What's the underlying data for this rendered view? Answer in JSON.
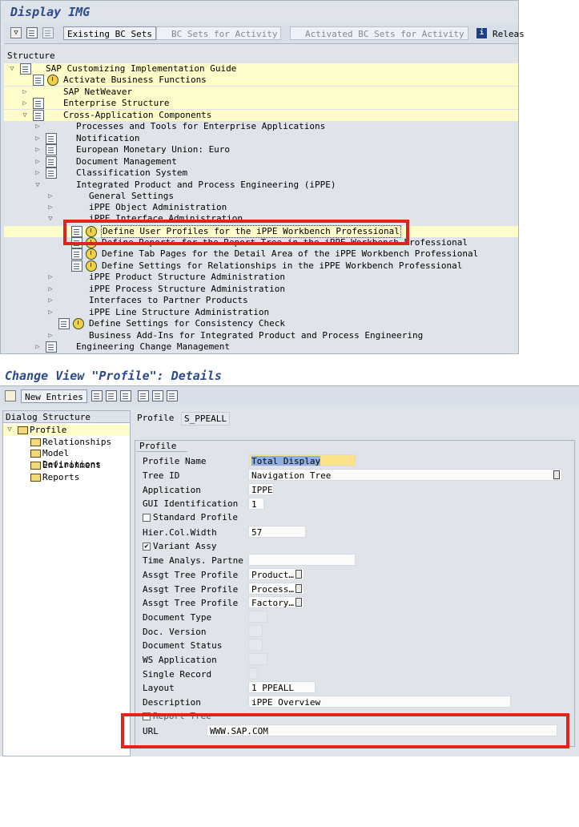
{
  "top": {
    "title": "Display IMG",
    "toolbar": {
      "existing_bc_sets": "Existing BC Sets",
      "bc_sets_for_activity": "BC Sets for Activity",
      "activated_bc_sets": "Activated BC Sets for Activity",
      "release": "Releas"
    },
    "structure_header": "Structure",
    "tree": [
      "SAP Customizing Implementation Guide",
      "Activate Business Functions",
      "SAP NetWeaver",
      "Enterprise Structure",
      "Cross-Application Components",
      "Processes and Tools for Enterprise Applications",
      "Notification",
      "European Monetary Union: Euro",
      "Document Management",
      "Classification System",
      "Integrated Product and Process Engineering (iPPE)",
      "General Settings",
      "iPPE Object Administration",
      "iPPE Interface Administration",
      "Define User Profiles for the iPPE Workbench Professional",
      "Define Reports for the Report Tree in the iPPE Workbench Professional",
      "Define Tab Pages for the Detail Area of the iPPE Workbench Professional",
      "Define Settings for Relationships in the iPPE Workbench Professional",
      "iPPE Product Structure Administration",
      "iPPE Process Structure Administration",
      "Interfaces to Partner Products",
      "iPPE Line Structure Administration",
      "Define Settings for Consistency Check",
      "Business Add-Ins for Integrated Product and Process Engineering",
      "Engineering Change Management"
    ]
  },
  "bottom": {
    "title": "Change View \"Profile\": Details",
    "toolbar": {
      "new_entries": "New Entries"
    },
    "dialog_structure": {
      "header": "Dialog Structure",
      "items": [
        "Profile",
        "Relationships",
        "Model Definitions",
        "Environment",
        "Reports"
      ]
    },
    "profile_key": {
      "label": "Profile",
      "value": "S_PPEALL"
    },
    "tab": "Profile",
    "labels": {
      "profile_name": "Profile Name",
      "tree_id": "Tree ID",
      "application": "Application",
      "gui_id": "GUI Identification",
      "standard_profile": "Standard Profile",
      "hier_col_width": "Hier.Col.Width",
      "variant_assy": "Variant Assy",
      "time_analys": "Time Analys. Partne",
      "assgt_tree_profile": "Assgt Tree Profile",
      "document_type": "Document Type",
      "doc_version": "Doc. Version",
      "document_status": "Document Status",
      "ws_application": "WS Application",
      "single_record": "Single Record",
      "layout": "Layout",
      "description": "Description",
      "report_tree": "Report Tree",
      "url": "URL"
    },
    "values": {
      "profile_name": "Total Display",
      "tree_id": "Navigation Tree",
      "application": "IPPE",
      "gui_id": "1",
      "hier_col_width": "57",
      "assgt1": "Product…",
      "assgt2": "Process…",
      "assgt3": "Factory…",
      "layout": "1_PPEALL",
      "description": "iPPE Overview",
      "url": "WWW.SAP.COM"
    },
    "checks": {
      "variant_assy": "✔"
    }
  },
  "colors": {
    "highlight": "#fefcc8",
    "red_box": "#e2231a",
    "title": "#2c4a8c"
  }
}
